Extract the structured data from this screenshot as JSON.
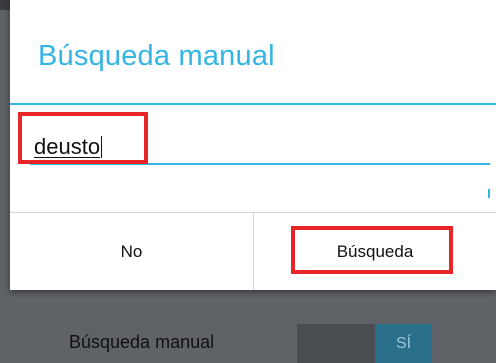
{
  "dialog": {
    "title": "Búsqueda manual",
    "search_value": "deusto",
    "buttons": {
      "no_label": "No",
      "search_label": "Búsqueda"
    }
  },
  "background": {
    "setting_label": "Búsqueda manual",
    "toggle_on_label": "SÍ"
  },
  "colors": {
    "accent": "#33b5e5",
    "highlight": "#e8262a",
    "toggle_on": "#2a6f8a"
  }
}
